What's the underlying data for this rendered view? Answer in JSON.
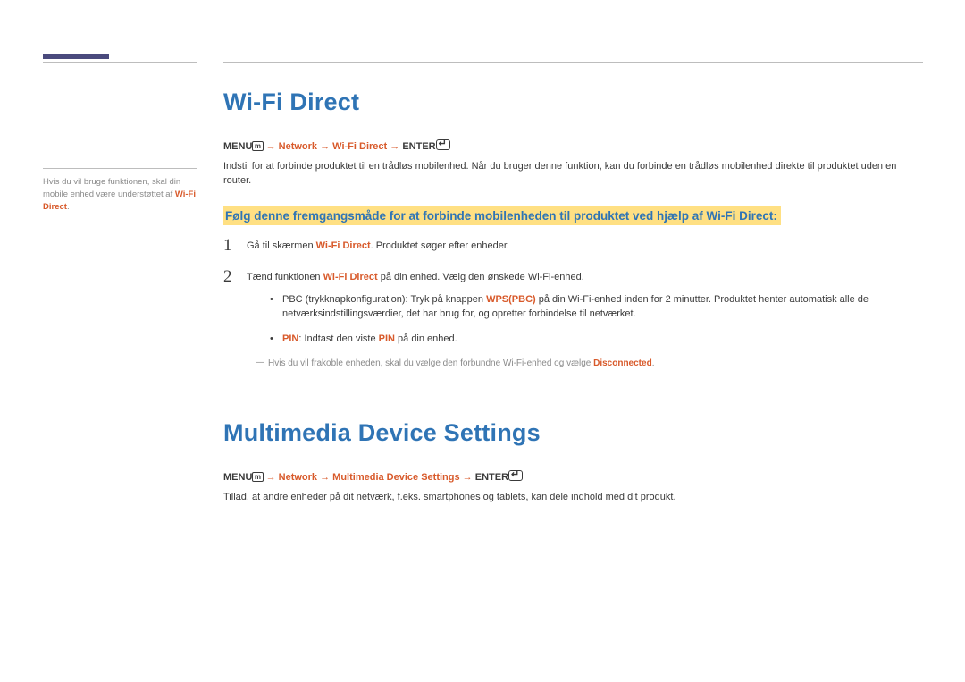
{
  "sidebar": {
    "note_pre": "Hvis du vil bruge funktionen, skal din mobile enhed være understøttet af ",
    "note_hl": "Wi-Fi Direct",
    "note_post": "."
  },
  "section1": {
    "title": "Wi-Fi Direct",
    "nav": {
      "menu": "MENU",
      "arrow": " → ",
      "p1": "Network",
      "p2": "Wi-Fi Direct",
      "enter": "ENTER"
    },
    "intro": "Indstil for at forbinde produktet til en trådløs mobilenhed. Når du bruger denne funktion, kan du forbinde en trådløs mobilenhed direkte til produktet uden en router.",
    "callout": "Følg denne fremgangsmåde for at forbinde mobilenheden til produktet ved hjælp af Wi-Fi Direct:",
    "step1": {
      "num": "1",
      "pre": "Gå til skærmen ",
      "hl": "Wi-Fi Direct",
      "post": ". Produktet søger efter enheder."
    },
    "step2": {
      "num": "2",
      "pre": "Tænd funktionen ",
      "hl": "Wi-Fi Direct",
      "post": " på din enhed. Vælg den ønskede Wi-Fi-enhed.",
      "pbc_pre": "PBC (trykknapkonfiguration): Tryk på knappen ",
      "pbc_hl": "WPS(PBC)",
      "pbc_post": " på din Wi-Fi-enhed inden for 2 minutter. Produktet henter automatisk alle de netværksindstillingsværdier, det har brug for, og opretter forbindelse til netværket.",
      "pin_hl1": "PIN",
      "pin_mid": ": Indtast den viste ",
      "pin_hl2": "PIN",
      "pin_post": " på din enhed."
    },
    "footnote_pre": "Hvis du vil frakoble enheden, skal du vælge den forbundne Wi-Fi-enhed og vælge ",
    "footnote_hl": "Disconnected",
    "footnote_post": "."
  },
  "section2": {
    "title": "Multimedia Device Settings",
    "nav": {
      "menu": "MENU",
      "arrow": " → ",
      "p1": "Network",
      "p2": "Multimedia Device Settings",
      "enter": "ENTER"
    },
    "body": "Tillad, at andre enheder på dit netværk, f.eks. smartphones og tablets, kan dele indhold med dit produkt."
  }
}
